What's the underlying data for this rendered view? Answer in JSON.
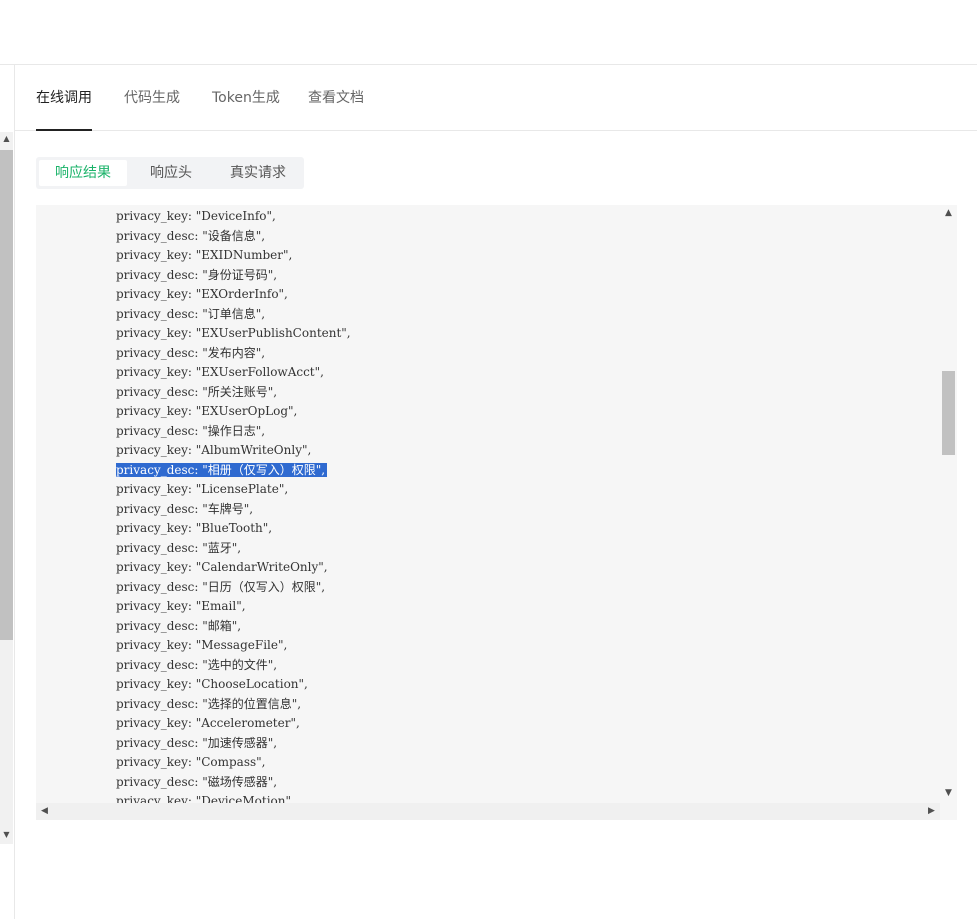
{
  "tabs": [
    {
      "label": "在线调用",
      "active": true
    },
    {
      "label": "代码生成",
      "active": false
    },
    {
      "label": "Token生成",
      "active": false
    },
    {
      "label": "查看文档",
      "active": false
    }
  ],
  "result_tabs": [
    {
      "label": "响应结果",
      "active": true
    },
    {
      "label": "响应头",
      "active": false
    },
    {
      "label": "真实请求",
      "active": false
    }
  ],
  "code_lines": [
    "privacy_key: \"DeviceInfo\",",
    "privacy_desc: \"设备信息\",",
    "privacy_key: \"EXIDNumber\",",
    "privacy_desc: \"身份证号码\",",
    "privacy_key: \"EXOrderInfo\",",
    "privacy_desc: \"订单信息\",",
    "privacy_key: \"EXUserPublishContent\",",
    "privacy_desc: \"发布内容\",",
    "privacy_key: \"EXUserFollowAcct\",",
    "privacy_desc: \"所关注账号\",",
    "privacy_key: \"EXUserOpLog\",",
    "privacy_desc: \"操作日志\",",
    "privacy_key: \"AlbumWriteOnly\",",
    "privacy_desc: \"相册（仅写入）权限\",",
    "privacy_key: \"LicensePlate\",",
    "privacy_desc: \"车牌号\",",
    "privacy_key: \"BlueTooth\",",
    "privacy_desc: \"蓝牙\",",
    "privacy_key: \"CalendarWriteOnly\",",
    "privacy_desc: \"日历（仅写入）权限\",",
    "privacy_key: \"Email\",",
    "privacy_desc: \"邮箱\",",
    "privacy_key: \"MessageFile\",",
    "privacy_desc: \"选中的文件\",",
    "privacy_key: \"ChooseLocation\",",
    "privacy_desc: \"选择的位置信息\",",
    "privacy_key: \"Accelerometer\",",
    "privacy_desc: \"加速传感器\",",
    "privacy_key: \"Compass\",",
    "privacy_desc: \"磁场传感器\",",
    "privacy_key: \"DeviceMotion\","
  ],
  "selected_line": 13,
  "colors": {
    "accent": "#1bb36a",
    "selection": "#2f6ad0"
  },
  "icons": {
    "scroll_up": "▲",
    "scroll_down": "▼",
    "scroll_left": "◀",
    "scroll_right": "▶"
  }
}
